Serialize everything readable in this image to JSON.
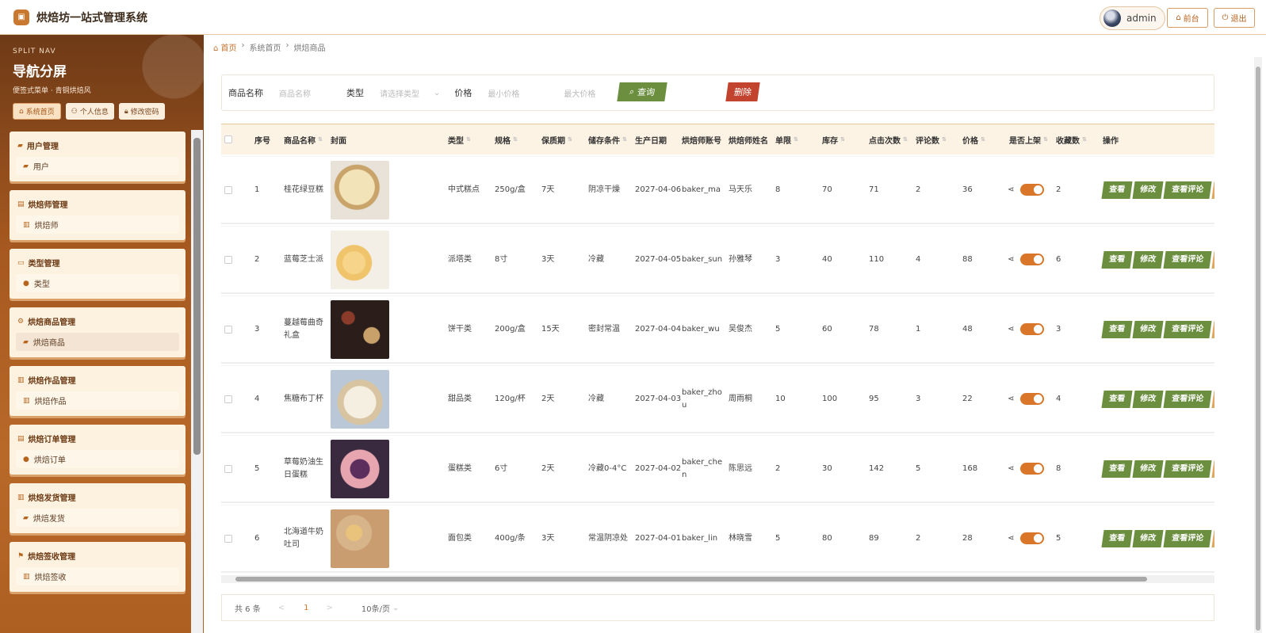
{
  "app": {
    "title": "烘焙坊一站式管理系统",
    "user": "admin",
    "front_label": "前台",
    "logout_label": "退出"
  },
  "sidebar": {
    "sub": "SPLIT NAV",
    "title": "导航分屏",
    "desc": "便签式菜单 · 青铜烘焙风",
    "tabs": [
      {
        "label": "系统首页"
      },
      {
        "label": "个人信息"
      },
      {
        "label": "修改密码"
      }
    ],
    "groups": [
      {
        "title": "用户管理",
        "item": "用户"
      },
      {
        "title": "烘焙师管理",
        "item": "烘焙师"
      },
      {
        "title": "类型管理",
        "item": "类型"
      },
      {
        "title": "烘焙商品管理",
        "item": "烘焙商品"
      },
      {
        "title": "烘焙作品管理",
        "item": "烘焙作品"
      },
      {
        "title": "烘焙订单管理",
        "item": "烘焙订单"
      },
      {
        "title": "烘焙发货管理",
        "item": "烘焙发货"
      },
      {
        "title": "烘焙签收管理",
        "item": "烘焙签收"
      }
    ]
  },
  "breadcrumb": {
    "home": "首页",
    "level1": "系统首页",
    "level2": "烘焙商品"
  },
  "filter": {
    "name_label": "商品名称",
    "name_placeholder": "商品名称",
    "type_label": "类型",
    "type_placeholder": "请选择类型",
    "price_label": "价格",
    "min_placeholder": "最小价格",
    "max_placeholder": "最大价格",
    "query_label": "查询",
    "delete_label": "删除"
  },
  "table": {
    "headers": {
      "index": "序号",
      "name": "商品名称",
      "cover": "封面",
      "type": "类型",
      "spec": "规格",
      "shelf": "保质期",
      "storage": "储存条件",
      "date": "生产日期",
      "account": "烘焙师账号",
      "baker": "烘焙师姓名",
      "limit": "单限",
      "stock": "库存",
      "clicks": "点击次数",
      "comments": "评论数",
      "price": "价格",
      "onshelf": "是否上架",
      "favs": "收藏数",
      "ops": "操作"
    },
    "actions": {
      "view": "查看",
      "edit": "修改",
      "comments": "查看评论"
    },
    "rows": [
      {
        "index": "1",
        "name": "桂花绿豆糕",
        "type": "中式糕点",
        "spec": "250g/盒",
        "shelf": "7天",
        "storage": "阴凉干燥",
        "date": "2027-04-06",
        "account": "baker_ma",
        "baker": "马天乐",
        "limit": "8",
        "stock": "70",
        "clicks": "71",
        "comments": "2",
        "price": "36",
        "favs": "2",
        "on": true
      },
      {
        "index": "2",
        "name": "蓝莓芝士派",
        "type": "派塔类",
        "spec": "8寸",
        "shelf": "3天",
        "storage": "冷藏",
        "date": "2027-04-05",
        "account": "baker_sun",
        "baker": "孙雅琴",
        "limit": "3",
        "stock": "40",
        "clicks": "110",
        "comments": "4",
        "price": "88",
        "favs": "6",
        "on": true
      },
      {
        "index": "3",
        "name": "蔓越莓曲奇礼盒",
        "type": "饼干类",
        "spec": "200g/盒",
        "shelf": "15天",
        "storage": "密封常温",
        "date": "2027-04-04",
        "account": "baker_wu",
        "baker": "吴俊杰",
        "limit": "5",
        "stock": "60",
        "clicks": "78",
        "comments": "1",
        "price": "48",
        "favs": "3",
        "on": true
      },
      {
        "index": "4",
        "name": "焦糖布丁杯",
        "type": "甜品类",
        "spec": "120g/杯",
        "shelf": "2天",
        "storage": "冷藏",
        "date": "2027-04-03",
        "account": "baker_zhou",
        "baker": "周雨桐",
        "limit": "10",
        "stock": "100",
        "clicks": "95",
        "comments": "3",
        "price": "22",
        "favs": "4",
        "on": true
      },
      {
        "index": "5",
        "name": "草莓奶油生日蛋糕",
        "type": "蛋糕类",
        "spec": "6寸",
        "shelf": "2天",
        "storage": "冷藏0-4°C",
        "date": "2027-04-02",
        "account": "baker_chen",
        "baker": "陈思远",
        "limit": "2",
        "stock": "30",
        "clicks": "142",
        "comments": "5",
        "price": "168",
        "favs": "8",
        "on": true
      },
      {
        "index": "6",
        "name": "北海道牛奶吐司",
        "type": "面包类",
        "spec": "400g/条",
        "shelf": "3天",
        "storage": "常温阴凉处",
        "date": "2027-04-01",
        "account": "baker_lin",
        "baker": "林晓雪",
        "limit": "5",
        "stock": "80",
        "clicks": "89",
        "comments": "2",
        "price": "28",
        "favs": "5",
        "on": true
      }
    ]
  },
  "pager": {
    "total": "共 6 条",
    "prev": "<",
    "page": "1",
    "next": ">",
    "size": "10条/页"
  }
}
